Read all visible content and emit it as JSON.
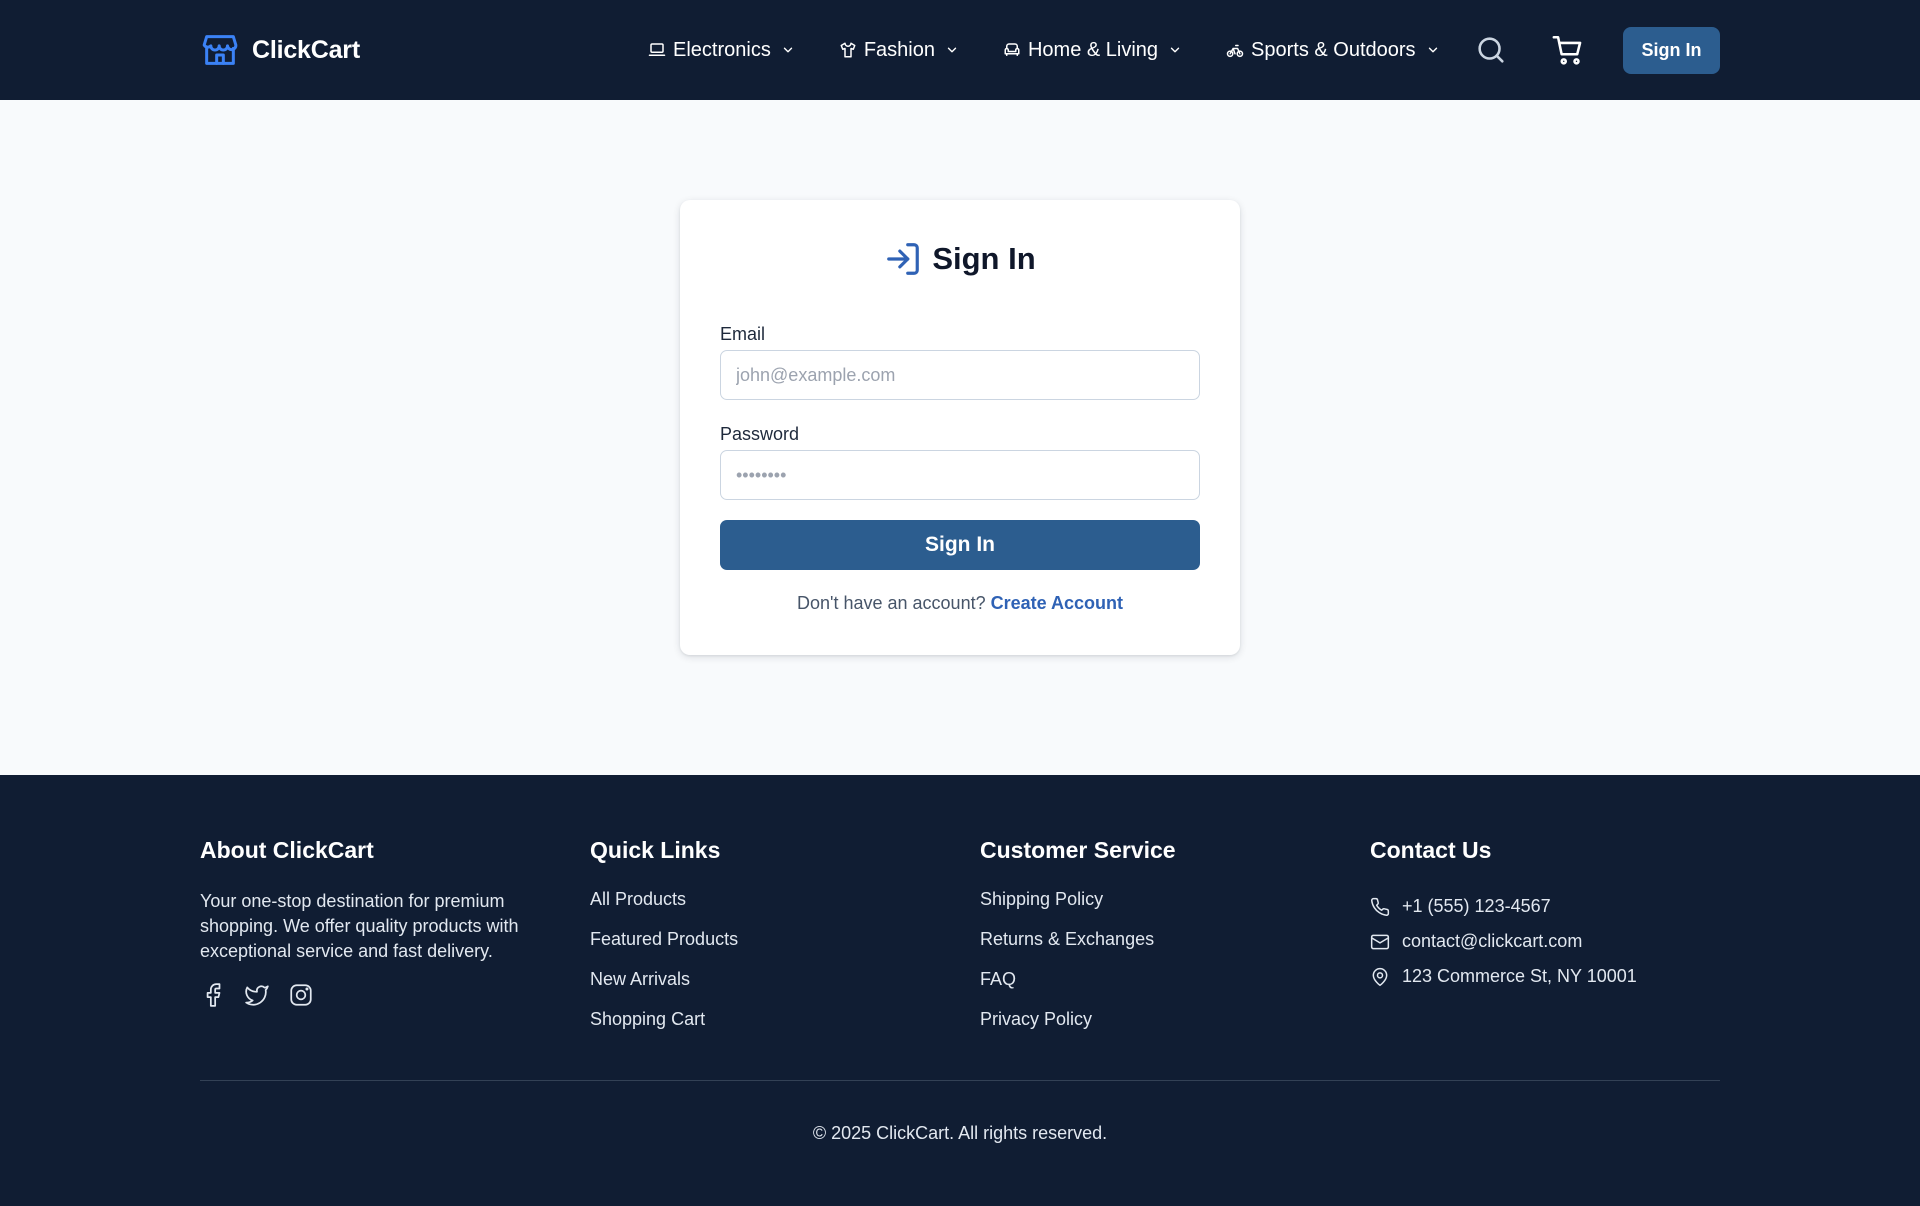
{
  "colors": {
    "header_bg": "#101d33",
    "page_bg": "#f8fafc",
    "primary": "#2c5d8f",
    "accent_blue": "#2f62b5",
    "footer_bg": "#101d33"
  },
  "header": {
    "brand": {
      "name": "ClickCart",
      "icon": "store-icon"
    },
    "nav": [
      {
        "label": "Electronics",
        "icon": "laptop-icon"
      },
      {
        "label": "Fashion",
        "icon": "shirt-icon"
      },
      {
        "label": "Home & Living",
        "icon": "sofa-icon"
      },
      {
        "label": "Sports & Outdoors",
        "icon": "bike-icon"
      }
    ],
    "search_icon": "search-icon",
    "cart_icon": "cart-icon",
    "signin_label": "Sign In"
  },
  "signin_card": {
    "title": "Sign In",
    "title_icon": "log-in-icon",
    "email_label": "Email",
    "email_placeholder": "john@example.com",
    "password_label": "Password",
    "password_placeholder": "••••••••",
    "submit_label": "Sign In",
    "register_prompt": "Don't have an account?",
    "register_link": "Create Account"
  },
  "footer": {
    "about": {
      "heading": "About ClickCart",
      "text": "Your one-stop destination for premium shopping. We offer quality products with exceptional service and fast delivery.",
      "socials": [
        "facebook-icon",
        "twitter-icon",
        "instagram-icon"
      ]
    },
    "quick_links": {
      "heading": "Quick Links",
      "items": [
        "All Products",
        "Featured Products",
        "New Arrivals",
        "Shopping Cart"
      ]
    },
    "customer_service": {
      "heading": "Customer Service",
      "items": [
        "Shipping Policy",
        "Returns & Exchanges",
        "FAQ",
        "Privacy Policy"
      ]
    },
    "contact": {
      "heading": "Contact Us",
      "phone": "+1 (555) 123-4567",
      "email": "contact@clickcart.com",
      "address": "123 Commerce St, NY 10001"
    },
    "copyright": "© 2025 ClickCart. All rights reserved."
  }
}
